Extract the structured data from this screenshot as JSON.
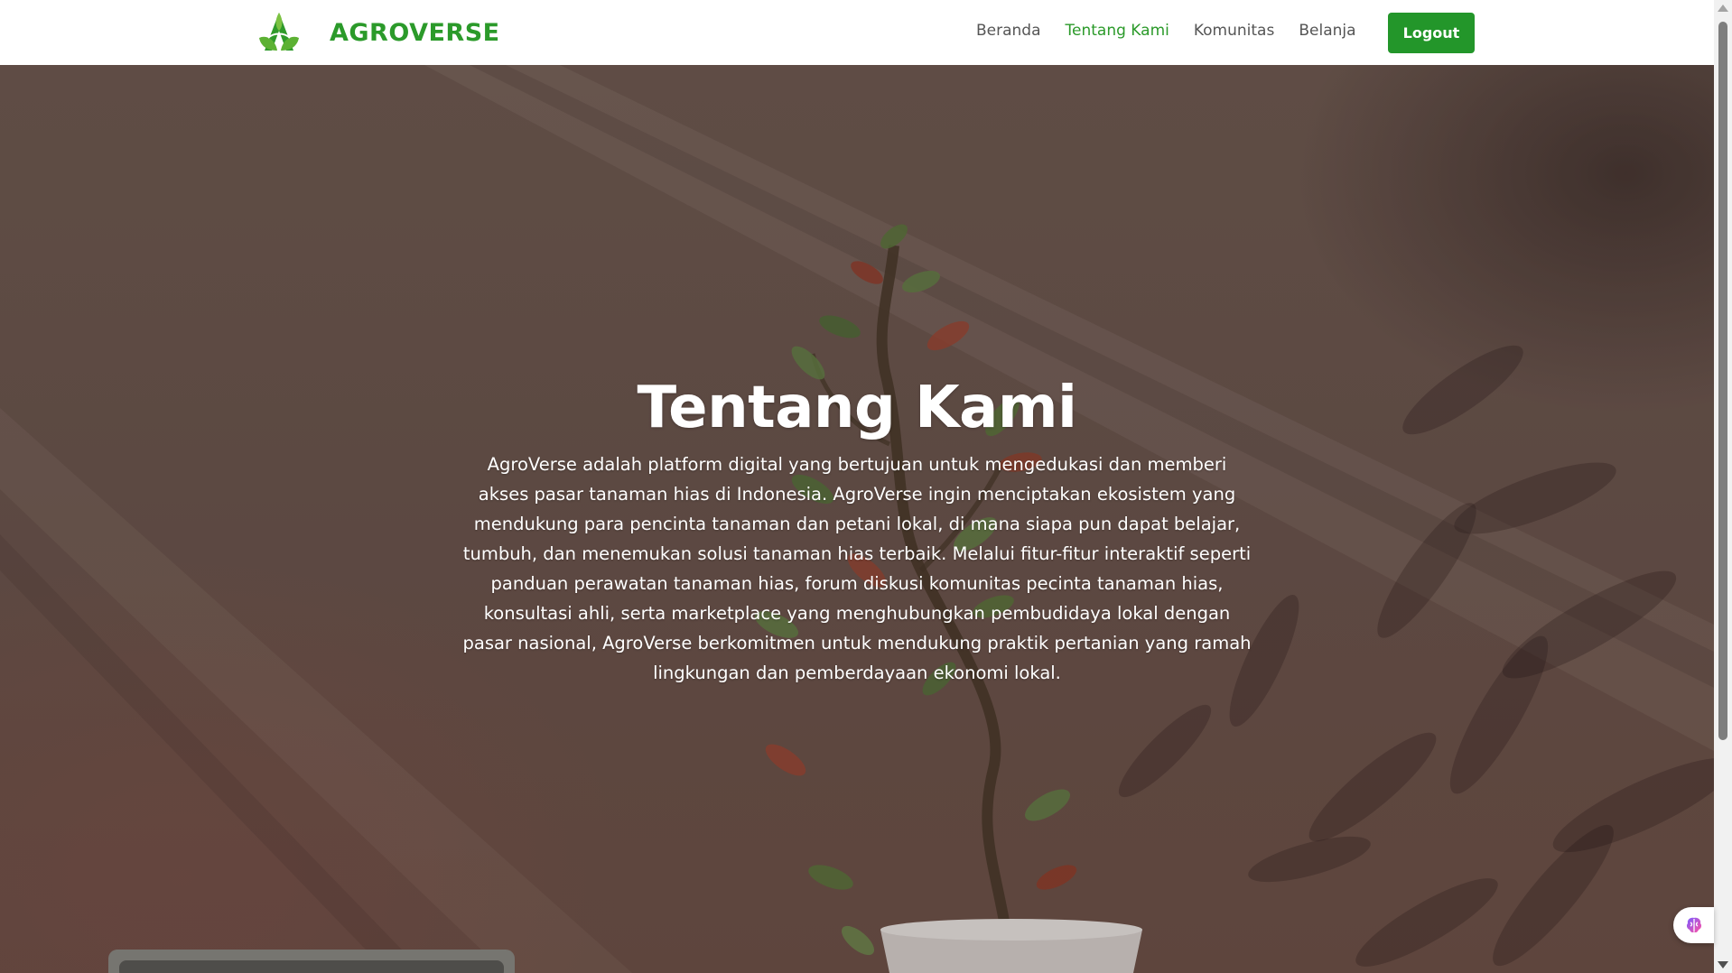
{
  "header": {
    "brand_name": "AGROVERSE",
    "brand_color": "#2b9a2a",
    "logo_icon": "agroverse-leaf-logo",
    "nav": [
      {
        "label": "Beranda",
        "active": false
      },
      {
        "label": "Tentang Kami",
        "active": true
      },
      {
        "label": "Komunitas",
        "active": false
      },
      {
        "label": "Belanja",
        "active": false
      }
    ],
    "logout_label": "Logout",
    "logout_color": "#23962a"
  },
  "hero": {
    "title": "Tentang Kami",
    "description": "AgroVerse adalah platform digital yang bertujuan untuk mengedukasi dan memberi akses pasar tanaman hias di Indonesia. AgroVerse ingin menciptakan ekosistem yang mendukung para pencinta tanaman dan petani lokal, di mana siapa pun dapat belajar, tumbuh, dan menemukan solusi tanaman hias terbaik. Melalui fitur-fitur interaktif seperti panduan perawatan tanaman hias, forum diskusi komunitas pecinta tanaman hias, konsultasi ahli, serta marketplace yang menghubungkan pembudidaya lokal dengan pasar nasional, AgroVerse berkomitmen untuk mendukung praktik pertanian yang ramah lingkungan dan pemberdayaan ekonomi lokal.",
    "background_image": "potted-plant-photo"
  },
  "widget": {
    "icon": "brain-icon"
  }
}
